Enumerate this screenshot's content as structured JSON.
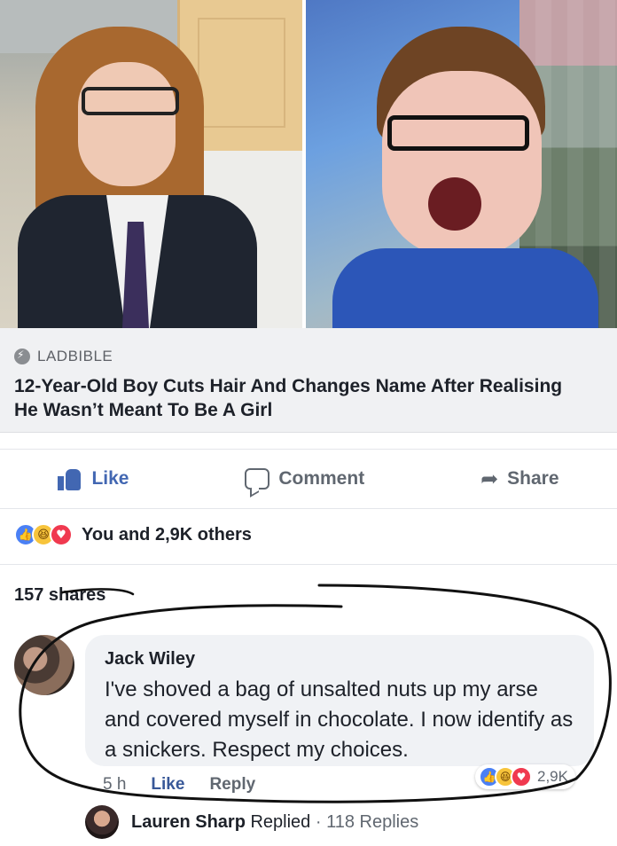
{
  "link_preview": {
    "source": "LADBIBLE",
    "headline": "12-Year-Old Boy Cuts Hair And Changes Name After Realising He Wasn’t Meant To Be A Girl"
  },
  "actions": {
    "like": "Like",
    "comment": "Comment",
    "share": "Share"
  },
  "reactions": {
    "summary": "You and 2,9K others",
    "icons": [
      "like-icon",
      "haha-icon",
      "love-icon"
    ]
  },
  "shares": "157 shares",
  "comment": {
    "author": "Jack Wiley",
    "text": "I've shoved a bag of unsalted nuts up my arse and covered myself in chocolate. I now identify as a snickers. Respect my choices.",
    "time": "5 h",
    "like": "Like",
    "reply": "Reply",
    "reaction_count": "2,9K"
  },
  "reply": {
    "name": "Lauren Sharp",
    "action": "Replied",
    "separator": "·",
    "count": "118 Replies"
  },
  "colors": {
    "brand_blue": "#4267b2",
    "scribble": "#111111"
  }
}
